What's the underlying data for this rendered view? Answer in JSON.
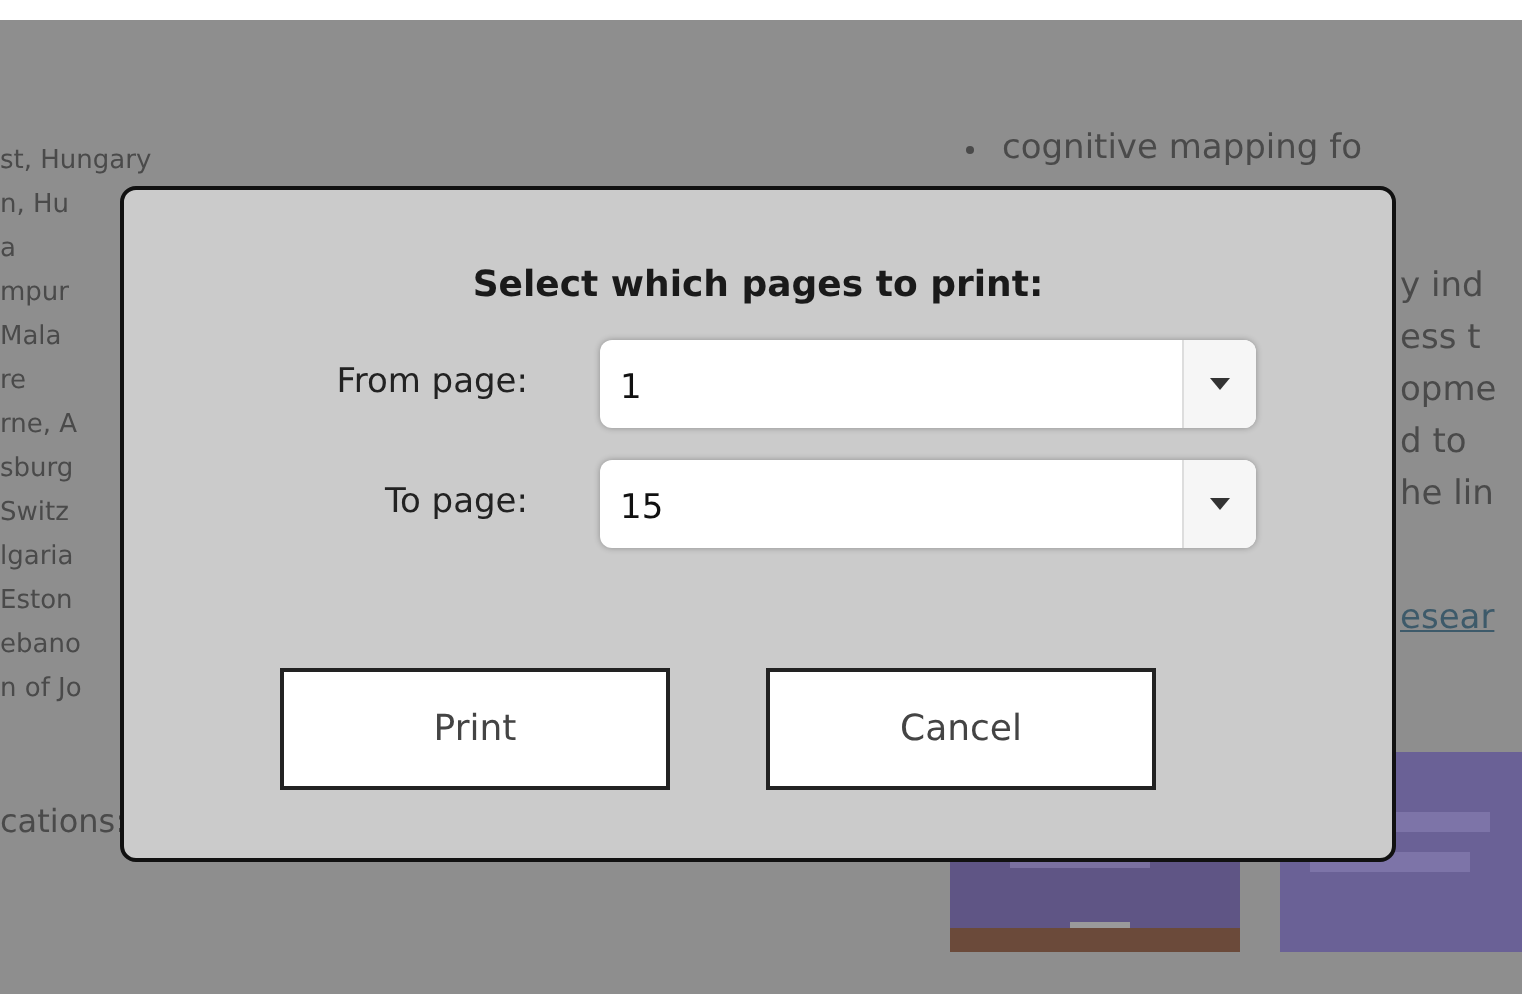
{
  "page": {
    "left_lines": [
      "st, Hungary",
      "n, Hu",
      "a",
      "mpur",
      "Mala",
      "re",
      "rne, A",
      "sburg",
      "Switz",
      "lgaria",
      "Eston",
      "ebano",
      "n of Jo"
    ],
    "bullet": "cognitive mapping fo",
    "right_lines": [
      "y ind",
      "ess t",
      "opme",
      "d to",
      "he lin"
    ],
    "link": "esear",
    "footer": "cations:"
  },
  "dialog": {
    "title": "Select which pages to print:",
    "fields": [
      {
        "label": "From page:",
        "value": "1"
      },
      {
        "label": "To page:",
        "value": "15"
      }
    ],
    "buttons": [
      "Print",
      "Cancel"
    ]
  }
}
